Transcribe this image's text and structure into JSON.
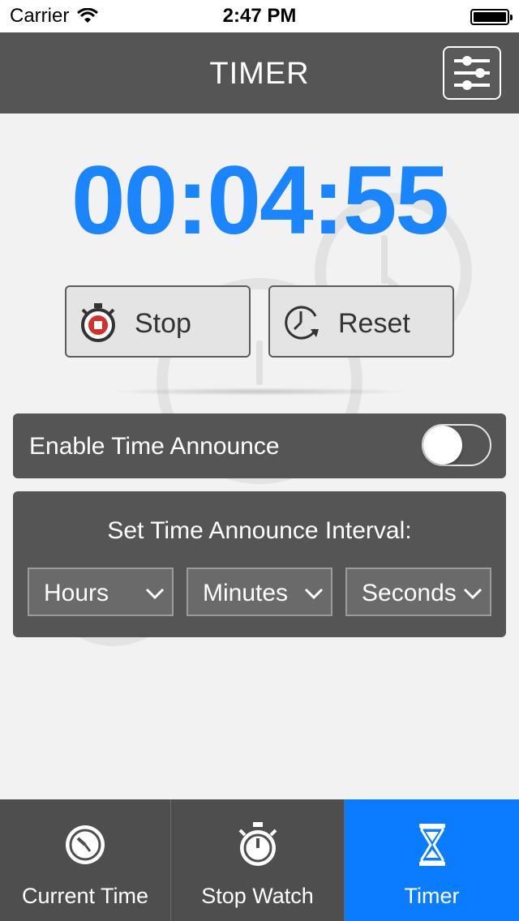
{
  "status_bar": {
    "carrier": "Carrier",
    "time": "2:47 PM",
    "wifi_icon": "wifi-icon",
    "battery_icon": "battery-icon"
  },
  "nav": {
    "title": "TIMER",
    "settings_icon": "sliders-icon"
  },
  "timer": {
    "display": "00:04:55",
    "color": "#1a85ff"
  },
  "controls": {
    "stop_label": "Stop",
    "reset_label": "Reset"
  },
  "announce": {
    "label": "Enable Time Announce",
    "enabled": false
  },
  "interval": {
    "title": "Set Time Announce Interval:",
    "pickers": [
      {
        "label": "Hours"
      },
      {
        "label": "Minutes"
      },
      {
        "label": "Seconds"
      }
    ]
  },
  "tabs": [
    {
      "label": "Current Time",
      "icon": "clock-icon",
      "selected": false
    },
    {
      "label": "Stop Watch",
      "icon": "stopwatch-icon",
      "selected": false
    },
    {
      "label": "Timer",
      "icon": "hourglass-icon",
      "selected": true
    }
  ],
  "colors": {
    "accent": "#0a7cff",
    "nav_bg": "#555555",
    "background": "#f2f2f2"
  }
}
